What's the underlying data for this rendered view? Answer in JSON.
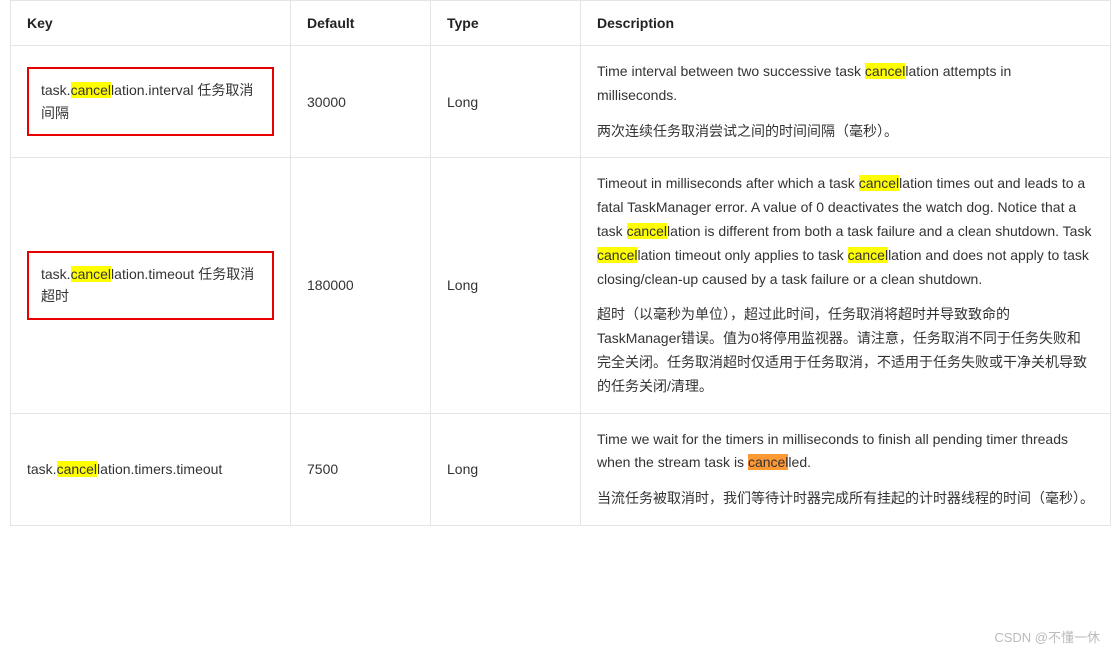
{
  "headers": {
    "key": "Key",
    "default": "Default",
    "type": "Type",
    "description": "Description"
  },
  "hl_word": "cancel",
  "rows": [
    {
      "key_pre": "task.",
      "key_mid": "lation.interval",
      "key_note_pre": "    任务取消间隔",
      "boxed": true,
      "default": "30000",
      "type": "Long",
      "desc_en_parts": [
        {
          "t": "Time interval between two successive task "
        },
        {
          "hl": "cancel"
        },
        {
          "t": "lation attempts in milliseconds."
        }
      ],
      "desc_cn": "两次连续任务取消尝试之间的时间间隔（毫秒）。"
    },
    {
      "key_pre": "task.",
      "key_mid": "lation.timeout",
      "key_note_pre": "    任务取消超时",
      "boxed": true,
      "default": "180000",
      "type": "Long",
      "desc_en_parts": [
        {
          "t": "Timeout in milliseconds after which a task "
        },
        {
          "hl": "cancel"
        },
        {
          "t": "lation times out and leads to a fatal TaskManager error. A value of 0 deactivates the watch dog. Notice that a task "
        },
        {
          "hl": "cancel"
        },
        {
          "t": "lation is different from both a task failure and a clean shutdown. Task "
        },
        {
          "hl": "cancel"
        },
        {
          "t": "lation timeout only applies to task "
        },
        {
          "hl": "cancel"
        },
        {
          "t": "lation and does not apply to task closing/clean-up caused by a task failure or a clean shutdown."
        }
      ],
      "desc_cn": "超时（以毫秒为单位），超过此时间，任务取消将超时并导致致命的TaskManager错误。值为0将停用监视器。请注意，任务取消不同于任务失败和完全关闭。任务取消超时仅适用于任务取消，不适用于任务失败或干净关机导致的任务关闭/清理。"
    },
    {
      "key_pre": "task.",
      "key_mid": "lation.timers.timeout",
      "key_note_pre": "",
      "boxed": false,
      "default": "7500",
      "type": "Long",
      "desc_en_parts": [
        {
          "t": "Time we wait for the timers in milliseconds to finish all pending timer threads when the stream task is "
        },
        {
          "hl_orange": "cancel"
        },
        {
          "t": "led."
        }
      ],
      "desc_cn": "当流任务被取消时，我们等待计时器完成所有挂起的计时器线程的时间（毫秒）。"
    }
  ],
  "watermark": "CSDN @不懂一休"
}
